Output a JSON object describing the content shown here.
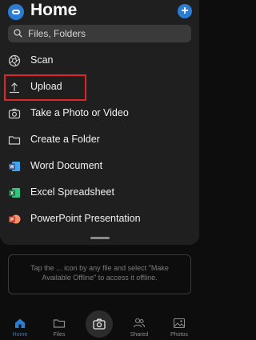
{
  "header": {
    "title": "Home",
    "add_label": "+"
  },
  "search": {
    "placeholder": "Files, Folders"
  },
  "menu": [
    {
      "label": "Scan",
      "icon": "camera-aperture-icon"
    },
    {
      "label": "Upload",
      "icon": "upload-icon"
    },
    {
      "label": "Take a Photo or Video",
      "icon": "camera-icon"
    },
    {
      "label": "Create a Folder",
      "icon": "folder-icon"
    },
    {
      "label": "Word Document",
      "icon": "word-icon"
    },
    {
      "label": "Excel Spreadsheet",
      "icon": "excel-icon"
    },
    {
      "label": "PowerPoint Presentation",
      "icon": "powerpoint-icon"
    }
  ],
  "offline_message": "Tap the ... icon by any file and select \"Make Available Offline\" to access it offline.",
  "tabs": [
    {
      "label": "Home",
      "active": true
    },
    {
      "label": "Files",
      "active": false
    },
    {
      "label": "Shared",
      "active": false
    },
    {
      "label": "Photos",
      "active": false
    }
  ],
  "colors": {
    "accent": "#2b7cd3",
    "highlight": "#e0242b",
    "word": "#2b5797",
    "excel": "#1e7145",
    "powerpoint": "#d24726"
  }
}
